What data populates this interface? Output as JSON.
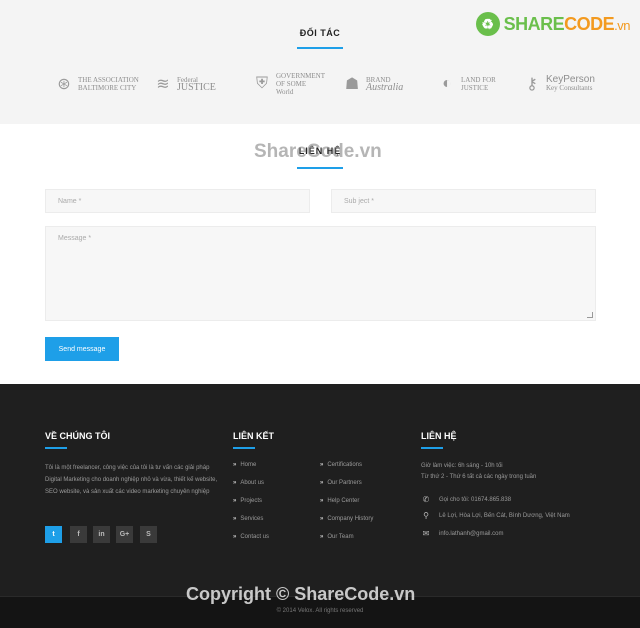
{
  "partners": {
    "title": "ĐỐI TÁC",
    "logos": [
      {
        "icon": "seal-icon",
        "line1": "THE ASSOCIATION",
        "line2": "BALTIMORE CITY"
      },
      {
        "icon": "flag-icon",
        "line1": "Federal",
        "line2": "JUSTICE"
      },
      {
        "icon": "shield-icon",
        "line1": "GOVERNMENT",
        "line2": "OF SOME",
        "line3": "World"
      },
      {
        "icon": "australia-map-icon",
        "line1": "BRAND",
        "line2": "Australia"
      },
      {
        "icon": "globe-icon",
        "line1": "LAND FOR",
        "line2": "JUSTICE"
      },
      {
        "icon": "key-icon",
        "line1": "KeyPerson",
        "line2": "Key Consultants"
      }
    ]
  },
  "brand": {
    "icon": "sharecode-logo-icon",
    "part1": "SHARE",
    "part2": "CODE",
    "suffix": ".vn"
  },
  "watermark_top": "ShareCode.vn",
  "contact": {
    "title": "LIÊN HỆ",
    "name_placeholder": "Name *",
    "subject_placeholder": "Sub ject *",
    "message_placeholder": "Message *",
    "send_label": "Send message"
  },
  "footer": {
    "about": {
      "title": "VỀ CHÚNG TÔI",
      "text": "Tôi là một freelancer, công việc của tôi là tư vấn các giải pháp Digital Marketing cho doanh nghiệp nhỏ và vừa, thiết kế website, SEO website, và sản xuất các video marketing chuyên nghiệp",
      "socials": [
        {
          "icon": "twitter-icon",
          "glyph": "t"
        },
        {
          "icon": "facebook-icon",
          "glyph": "f"
        },
        {
          "icon": "linkedin-icon",
          "glyph": "in"
        },
        {
          "icon": "google-plus-icon",
          "glyph": "G+"
        },
        {
          "icon": "skype-icon",
          "glyph": "S"
        }
      ]
    },
    "links": {
      "title": "LIÊN KẾT",
      "col1": [
        "Home",
        "About us",
        "Projects",
        "Services",
        "Contact us"
      ],
      "col2": [
        "Certifications",
        "Our Partners",
        "Help Center",
        "Company History",
        "Our Team"
      ]
    },
    "contact": {
      "title": "LIÊN HỆ",
      "hours1": "Giờ làm việc: 6h sáng - 10h tối",
      "hours2": "Từ thứ 2 - Thứ 6 tất cả các ngày trong tuần",
      "phone": "Gọi cho tôi: 01674.865.838",
      "address": "Lê Lợi, Hòa Lợi, Bến Cát, Bình Dương, Việt Nam",
      "email": "info.lathanh@gmail.com"
    },
    "copyright": "© 2014 Velox. All rights reserved",
    "watermark": "Copyright © ShareCode.vn"
  }
}
